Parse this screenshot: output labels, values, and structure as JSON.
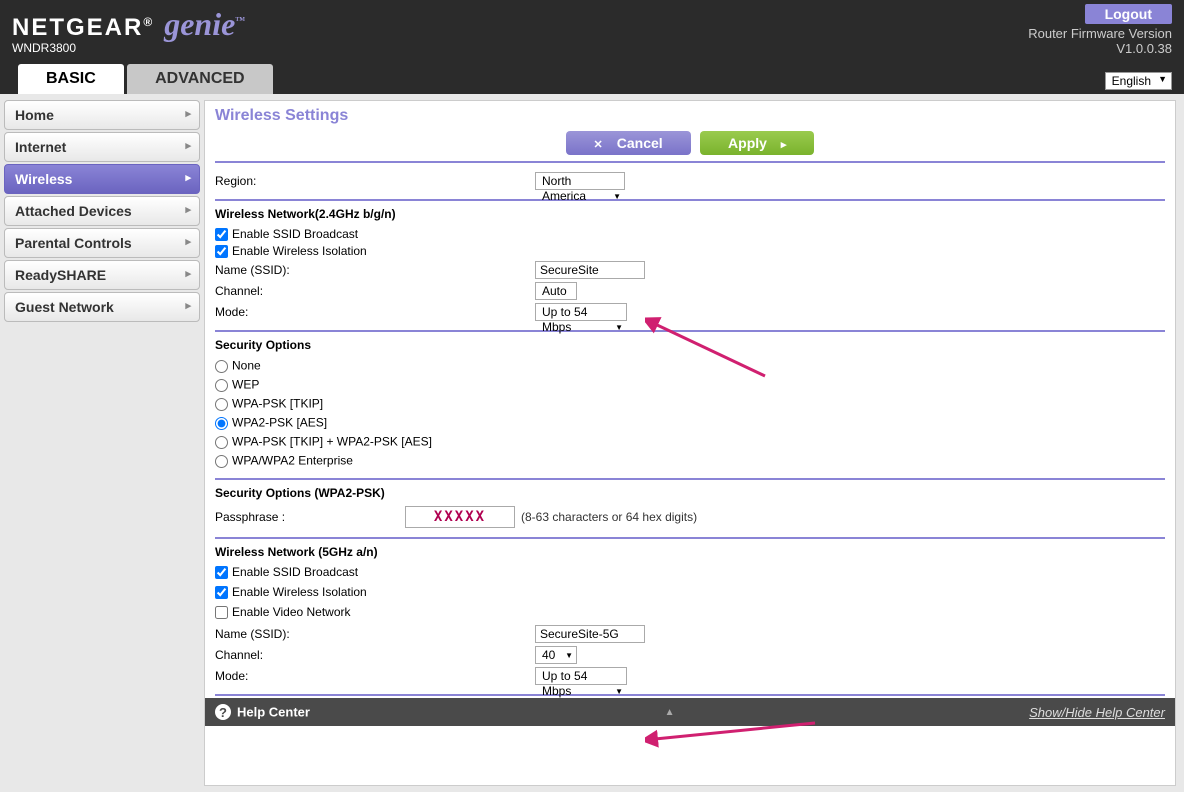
{
  "header": {
    "brand1": "NETGEAR",
    "brand2": "genie",
    "model": "WNDR3800",
    "logout": "Logout",
    "firmware_label": "Router Firmware Version",
    "firmware_value": "V1.0.0.38",
    "language": "English"
  },
  "tabs": {
    "basic": "BASIC",
    "advanced": "ADVANCED"
  },
  "sidebar": {
    "items": [
      {
        "label": "Home"
      },
      {
        "label": "Internet"
      },
      {
        "label": "Wireless"
      },
      {
        "label": "Attached Devices"
      },
      {
        "label": "Parental Controls"
      },
      {
        "label": "ReadySHARE"
      },
      {
        "label": "Guest Network"
      }
    ]
  },
  "page": {
    "title": "Wireless Settings",
    "cancel": "Cancel",
    "apply": "Apply",
    "region_label": "Region:",
    "region_value": "North America",
    "net24": {
      "heading": "Wireless Network(2.4GHz b/g/n)",
      "ssid_broadcast": "Enable SSID Broadcast",
      "wireless_isolation": "Enable Wireless Isolation",
      "name_label": "Name (SSID):",
      "name_value": "SecureSite",
      "channel_label": "Channel:",
      "channel_value": "Auto",
      "mode_label": "Mode:",
      "mode_value": "Up to 54 Mbps"
    },
    "security": {
      "heading": "Security Options",
      "opt_none": "None",
      "opt_wep": "WEP",
      "opt_wpa_tkip": "WPA-PSK [TKIP]",
      "opt_wpa2_aes": "WPA2-PSK [AES]",
      "opt_both": "WPA-PSK [TKIP] + WPA2-PSK [AES]",
      "opt_enterprise": "WPA/WPA2 Enterprise"
    },
    "passphrase": {
      "heading": "Security Options (WPA2-PSK)",
      "label": "Passphrase :",
      "value": "XXXXX",
      "hint": "(8-63 characters or 64 hex digits)"
    },
    "net5": {
      "heading": "Wireless Network (5GHz a/n)",
      "ssid_broadcast": "Enable SSID Broadcast",
      "wireless_isolation": "Enable Wireless Isolation",
      "video_network": "Enable Video Network",
      "name_label": "Name (SSID):",
      "name_value": "SecureSite-5G",
      "channel_label": "Channel:",
      "channel_value": "40",
      "mode_label": "Mode:",
      "mode_value": "Up to 54 Mbps"
    }
  },
  "footer": {
    "help": "Help Center",
    "showhide": "Show/Hide Help Center"
  }
}
